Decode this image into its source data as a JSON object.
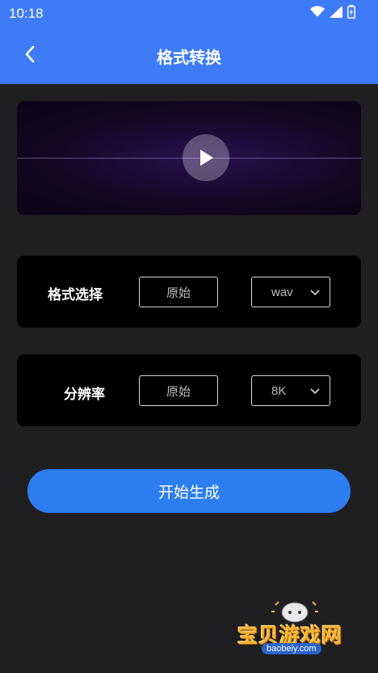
{
  "status_bar": {
    "time": "10:18"
  },
  "header": {
    "title": "格式转换"
  },
  "format_option": {
    "label": "格式选择",
    "original_label": "原始",
    "selected": "wav"
  },
  "resolution_option": {
    "label": "分辨率",
    "original_label": "原始",
    "selected": "8K"
  },
  "start_button": {
    "label": "开始生成"
  },
  "watermark": {
    "title": "宝贝游戏网",
    "url": "baobeiy.com"
  },
  "icons": {
    "back": "chevron-left-icon",
    "play": "play-icon",
    "dropdown": "chevron-down-icon",
    "wifi": "wifi-icon",
    "signal": "signal-icon",
    "battery": "battery-icon"
  },
  "colors": {
    "header": "#3d7bf7",
    "background": "#1f1f21",
    "card": "#000000",
    "button": "#2d7ef0",
    "wave_start": "#3fb4e8",
    "wave_end": "#c85af0"
  }
}
